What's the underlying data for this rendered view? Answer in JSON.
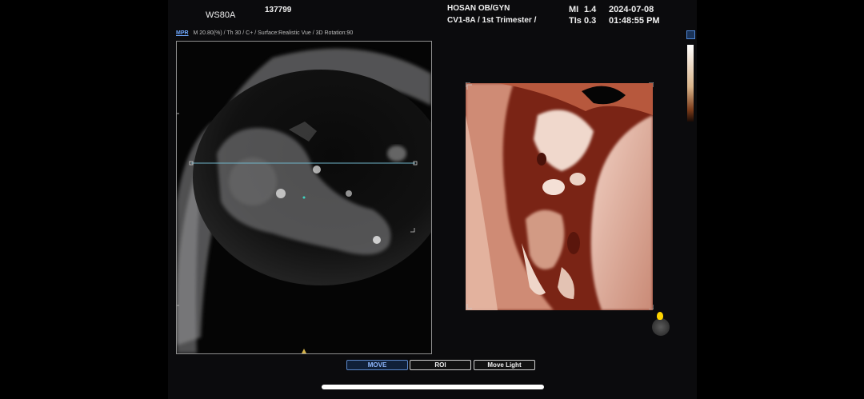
{
  "header": {
    "model": "WS80A",
    "patient_id": "137799",
    "hospital": "HOSAN OB/GYN",
    "probe": "CV1-8A / 1st Trimester /",
    "mi_label": "MI",
    "mi_value": "1.4",
    "tis_label": "TIs",
    "tis_value": "0.3",
    "date": "2024-07-08",
    "time": "01:48:55 PM"
  },
  "info": {
    "mode": "MPR",
    "params": "M 20.80(%) / Th 30 / C+ / Surface:Realistic Vue / 3D Rotation:90"
  },
  "buttons": {
    "move": "MOVE",
    "roi": "ROI",
    "move_light": "Move Light"
  },
  "colors": {
    "accent": "#5a86c8",
    "render_tone": "#b5452a"
  },
  "icons": {
    "top_right": "view-layout-icon",
    "light": "light-source-icon"
  }
}
